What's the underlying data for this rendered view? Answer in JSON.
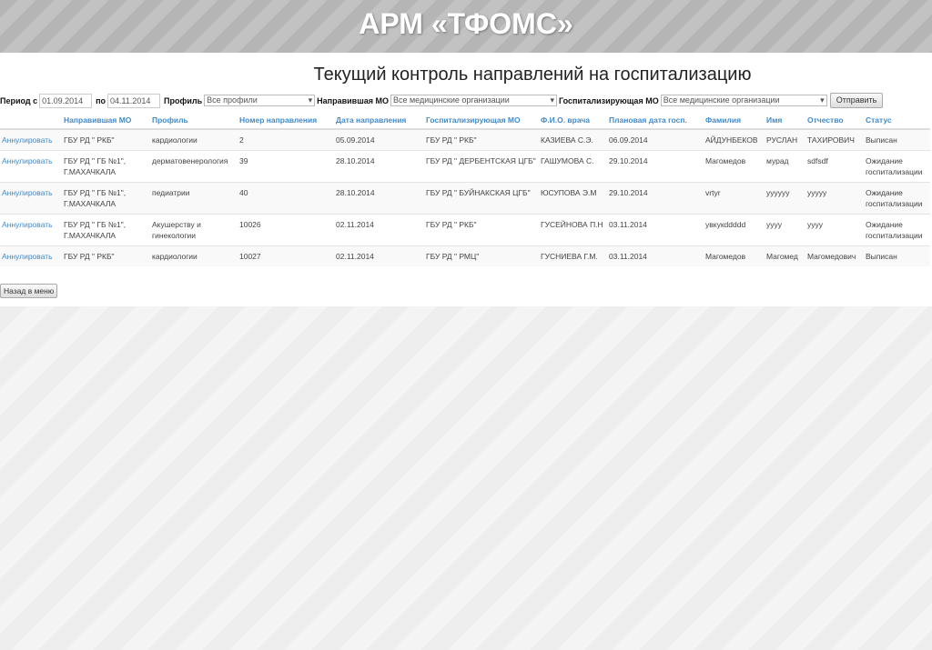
{
  "header": {
    "title": "АРМ «ТФОМС»"
  },
  "page_title": "Текущий контроль направлений на госпитализацию",
  "filters": {
    "period_from_label": "Период с",
    "period_from": "01.09.2014",
    "period_to_label": "по",
    "period_to": "04.11.2014",
    "profile_label": "Профиль",
    "profile_value": "Все профили",
    "referring_label": "Направившая МО",
    "referring_value": "Все медицинские организации",
    "hosp_label": "Госпитализирующая МО",
    "hosp_value": "Все медицинские организации",
    "submit": "Отправить"
  },
  "table": {
    "headers": [
      "",
      "Направившая МО",
      "Профиль",
      "Номер направления",
      "Дата направления",
      "Госпитализирующая МО",
      "Ф.И.О. врача",
      "Плановая дата госп.",
      "Фамилия",
      "Имя",
      "Отчество",
      "Статус"
    ],
    "rows": [
      [
        "Аннулировать",
        "ГБУ РД \" РКБ\"",
        "кардиологии",
        "2",
        "05.09.2014",
        "ГБУ РД \" РКБ\"",
        "КАЗИЕВА С.Э.",
        "06.09.2014",
        "АЙДУНБЕКОВ",
        "РУСЛАН",
        "ТАХИРОВИЧ",
        "Выписан"
      ],
      [
        "Аннулировать",
        "ГБУ РД \" ГБ №1\", Г.МАХАЧКАЛА",
        "дерматовенерология",
        "39",
        "28.10.2014",
        "ГБУ РД \" ДЕРБЕНТСКАЯ ЦГБ\"",
        "ГАШУМОВА С.",
        "29.10.2014",
        "Магомедов",
        "мурад",
        "sdfsdf",
        "Ожидание госпитализации"
      ],
      [
        "Аннулировать",
        "ГБУ РД \" ГБ №1\", Г.МАХАЧКАЛА",
        "педиатрии",
        "40",
        "28.10.2014",
        "ГБУ РД \" БУЙНАКСКАЯ ЦГБ\"",
        "ЮСУПОВА Э.М",
        "29.10.2014",
        "vrtyr",
        "yyyyyy",
        "yyyyy",
        "Ожидание госпитализации"
      ],
      [
        "Аннулировать",
        "ГБУ РД \" ГБ №1\", Г.МАХАЧКАЛА",
        "Акушерству и гинекологии",
        "10026",
        "02.11.2014",
        "ГБУ РД \" РКБ\"",
        "ГУСЕЙНОВА П.Н",
        "03.11.2014",
        "увкукddddd",
        "yyyy",
        "yyyy",
        "Ожидание госпитализации"
      ],
      [
        "Аннулировать",
        "ГБУ РД \" РКБ\"",
        "кардиологии",
        "10027",
        "02.11.2014",
        "ГБУ РД \" РМЦ\"",
        "ГУСНИЕВА Г.М.",
        "03.11.2014",
        "Магомедов",
        "Магомед",
        "Магомедович",
        "Выписан"
      ]
    ]
  },
  "back_button": "Назад в меню"
}
